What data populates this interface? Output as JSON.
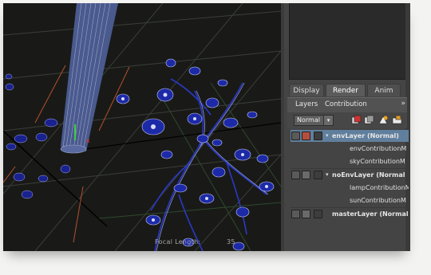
{
  "viewport": {
    "hud_label": "Focal Length:",
    "hud_value": "35"
  },
  "render_panel": {
    "tabs": [
      {
        "label": "Display",
        "active": false
      },
      {
        "label": "Render",
        "active": true
      },
      {
        "label": "Anim",
        "active": false
      }
    ],
    "subtabs": {
      "layers_label": "Layers",
      "contribution_label": "Contribution",
      "more_glyph": "»"
    },
    "blend_mode": {
      "selected": "Normal",
      "arrow": "▾"
    },
    "layers": [
      {
        "label": "envLayer (Normal)",
        "kind": "layer",
        "selected": true
      },
      {
        "label": "envContributionM",
        "kind": "contribution"
      },
      {
        "label": "skyContributionM",
        "kind": "contribution"
      },
      {
        "label": "noEnvLayer (Normal",
        "kind": "layer",
        "selected": false
      },
      {
        "label": "lampContributionM",
        "kind": "contribution"
      },
      {
        "label": "sunContributionM",
        "kind": "contribution"
      },
      {
        "label": "masterLayer (Normal)",
        "kind": "layer",
        "selected": false
      }
    ]
  },
  "colors": {
    "selection": "#607f9d",
    "viewport_bg": "#191a17",
    "mesh_blue": "#2a38c8"
  }
}
